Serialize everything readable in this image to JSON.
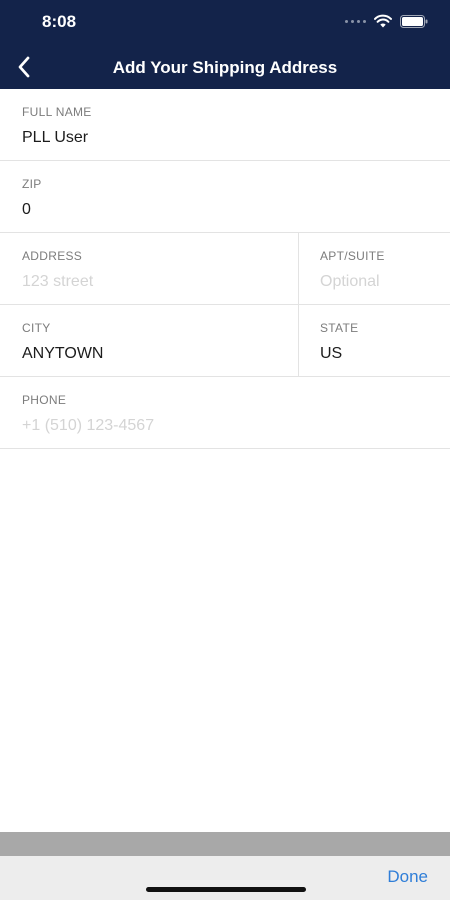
{
  "status_bar": {
    "time": "8:08"
  },
  "header": {
    "title": "Add Your Shipping Address"
  },
  "form": {
    "full_name": {
      "label": "FULL NAME",
      "value": "PLL User",
      "placeholder": ""
    },
    "zip": {
      "label": "ZIP",
      "value": "0",
      "placeholder": ""
    },
    "address": {
      "label": "ADDRESS",
      "value": "",
      "placeholder": "123 street"
    },
    "apt_suite": {
      "label": "APT/SUITE",
      "value": "",
      "placeholder": "Optional"
    },
    "city": {
      "label": "CITY",
      "value": "ANYTOWN",
      "placeholder": ""
    },
    "state": {
      "label": "STATE",
      "value": "US",
      "placeholder": ""
    },
    "phone": {
      "label": "PHONE",
      "value": "",
      "placeholder": "+1 (510) 123-4567"
    }
  },
  "keyboard_toolbar": {
    "done_label": "Done"
  },
  "colors": {
    "header_bg": "#13234a",
    "accent": "#2f7ed8"
  }
}
